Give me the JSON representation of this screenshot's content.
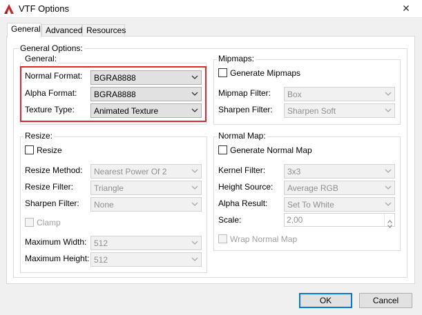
{
  "window": {
    "title": "VTF Options",
    "close_glyph": "✕",
    "app_icon": "vtf-app-icon"
  },
  "tabs": [
    {
      "label": "General",
      "active": true
    },
    {
      "label": "Advanced",
      "active": false
    },
    {
      "label": "Resources",
      "active": false
    }
  ],
  "general_options": {
    "caption": "General Options:",
    "general": {
      "caption": "General:",
      "normal_format": {
        "label": "Normal Format:",
        "value": "BGRA8888"
      },
      "alpha_format": {
        "label": "Alpha Format:",
        "value": "BGRA8888"
      },
      "texture_type": {
        "label": "Texture Type:",
        "value": "Animated Texture"
      }
    },
    "mipmaps": {
      "caption": "Mipmaps:",
      "generate": {
        "label": "Generate Mipmaps",
        "checked": false
      },
      "filter": {
        "label": "Mipmap Filter:",
        "value": "Box"
      },
      "sharpen": {
        "label": "Sharpen Filter:",
        "value": "Sharpen Soft"
      }
    },
    "resize": {
      "caption": "Resize:",
      "resize": {
        "label": "Resize",
        "checked": false
      },
      "method": {
        "label": "Resize Method:",
        "value": "Nearest Power Of 2"
      },
      "filter": {
        "label": "Resize Filter:",
        "value": "Triangle"
      },
      "sharpen": {
        "label": "Sharpen Filter:",
        "value": "None"
      },
      "clamp": {
        "label": "Clamp",
        "checked": false
      },
      "max_width": {
        "label": "Maximum Width:",
        "value": "512"
      },
      "max_height": {
        "label": "Maximum Height:",
        "value": "512"
      }
    },
    "normal_map": {
      "caption": "Normal Map:",
      "generate": {
        "label": "Generate Normal Map",
        "checked": false
      },
      "kernel": {
        "label": "Kernel Filter:",
        "value": "3x3"
      },
      "height_source": {
        "label": "Height Source:",
        "value": "Average RGB"
      },
      "alpha_result": {
        "label": "Alpha Result:",
        "value": "Set To White"
      },
      "scale": {
        "label": "Scale:",
        "value": "2,00"
      },
      "wrap": {
        "label": "Wrap Normal Map",
        "checked": false
      }
    }
  },
  "buttons": {
    "ok": "OK",
    "cancel": "Cancel"
  },
  "colors": {
    "highlight": "#e0232c",
    "default_button_border": "#0078d7",
    "window_bg": "#f0f0f0"
  }
}
